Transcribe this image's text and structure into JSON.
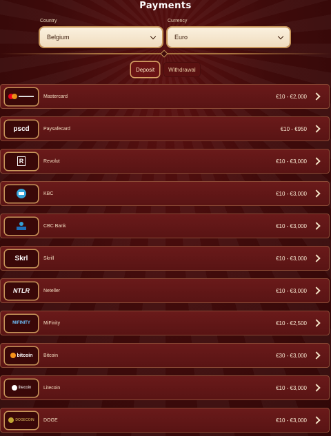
{
  "header": {
    "title": "Payments"
  },
  "filters": {
    "country_label": "Country",
    "country_value": "Belgium",
    "currency_label": "Currency",
    "currency_value": "Euro"
  },
  "tabs": [
    {
      "label": "Deposit",
      "active": true
    },
    {
      "label": "Withdrawal",
      "active": false
    }
  ],
  "methods": [
    {
      "name": "Mastercard",
      "range": "€10 - €2,000",
      "icon": "mastercard-logo"
    },
    {
      "name": "Paysafecard",
      "range": "€10 - €950",
      "icon": "paysafecard-logo",
      "logo_text": "pscd"
    },
    {
      "name": "Revolut",
      "range": "€10 - €3,000",
      "icon": "revolut-logo",
      "logo_text": "R"
    },
    {
      "name": "KBC",
      "range": "€10 - €3,000",
      "icon": "kbc-logo"
    },
    {
      "name": "CBC Bank",
      "range": "€10 - €3,000",
      "icon": "cbc-bank-logo"
    },
    {
      "name": "Skrill",
      "range": "€10 - €3,000",
      "icon": "skrill-logo",
      "logo_text": "Skrl"
    },
    {
      "name": "Neteller",
      "range": "€10 - €3,000",
      "icon": "neteller-logo",
      "logo_text": "NTLR"
    },
    {
      "name": "MiFinity",
      "range": "€10 - €2,500",
      "icon": "mifinity-logo",
      "logo_text": "MIFINITY"
    },
    {
      "name": "Bitcoin",
      "range": "€30 - €3,000",
      "icon": "bitcoin-logo",
      "logo_text": "bitcoin"
    },
    {
      "name": "Litecoin",
      "range": "€10 - €3,000",
      "icon": "litecoin-logo",
      "logo_text": "litecoin"
    },
    {
      "name": "DOGE",
      "range": "€10 - €3,000",
      "icon": "dogecoin-logo",
      "logo_text": "DOGECOIN"
    }
  ]
}
